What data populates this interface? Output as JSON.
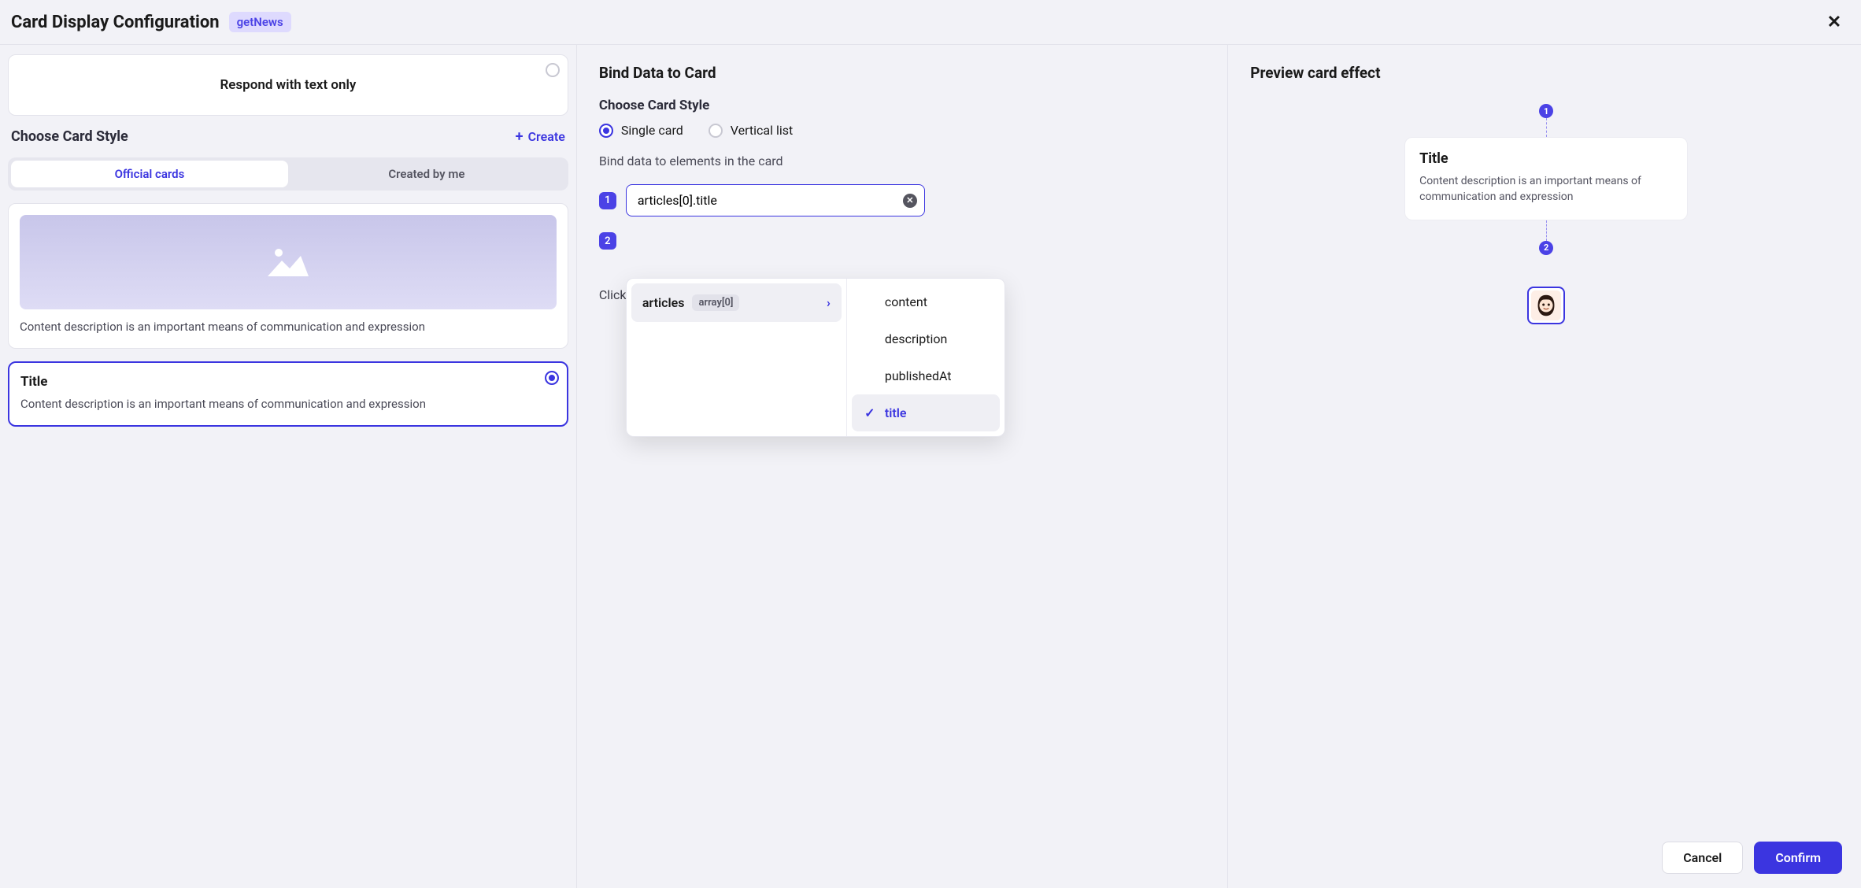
{
  "header": {
    "title": "Card Display Configuration",
    "tag": "getNews"
  },
  "left": {
    "respond_text_only": "Respond with text only",
    "choose_style": "Choose Card Style",
    "create": "Create",
    "tabs": {
      "official": "Official cards",
      "created": "Created by me"
    },
    "card_desc": "Content description is an important means of communication and expression",
    "card_title": "Title"
  },
  "mid": {
    "title": "Bind Data to Card",
    "choose_style": "Choose Card Style",
    "radio_single": "Single card",
    "radio_vertical": "Vertical list",
    "bind_elements": "Bind data to elements in the card",
    "input1_value": "articles[0].title",
    "click_partial": "Click",
    "dropdown": {
      "left_item": "articles",
      "left_type": "array[0]",
      "right": [
        "content",
        "description",
        "publishedAt",
        "title"
      ],
      "selected": "title"
    }
  },
  "right": {
    "title": "Preview card effect",
    "card_title": "Title",
    "card_desc": "Content description is an important means of communication and expression",
    "marker1": "1",
    "marker2": "2"
  },
  "footer": {
    "cancel": "Cancel",
    "confirm": "Confirm"
  }
}
